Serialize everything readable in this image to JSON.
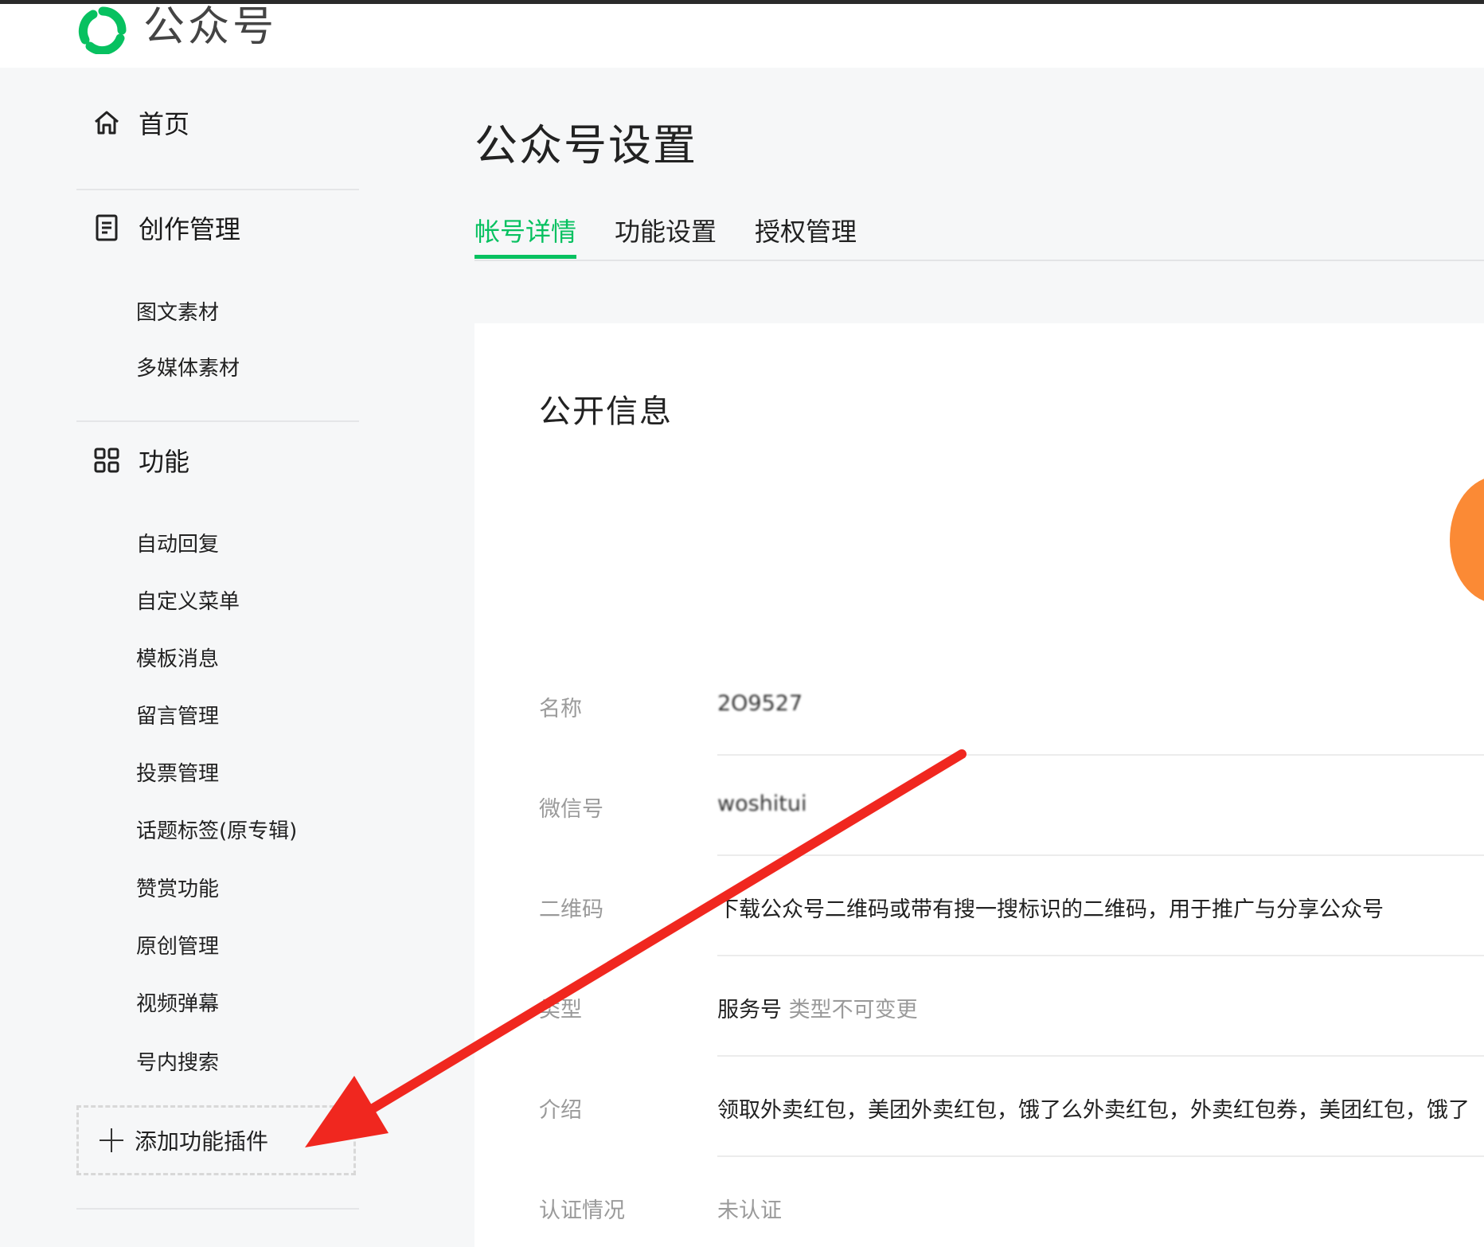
{
  "header": {
    "brand": "公众号"
  },
  "sidebar": {
    "home": "首页",
    "creation": {
      "title": "创作管理",
      "items": [
        "图文素材",
        "多媒体素材"
      ]
    },
    "features": {
      "title": "功能",
      "items": [
        "自动回复",
        "自定义菜单",
        "模板消息",
        "留言管理",
        "投票管理",
        "话题标签(原专辑)",
        "赞赏功能",
        "原创管理",
        "视频弹幕",
        "号内搜索"
      ]
    },
    "add_plugin": "添加功能插件"
  },
  "main": {
    "title": "公众号设置",
    "tabs": [
      "帐号详情",
      "功能设置",
      "授权管理"
    ],
    "section_title": "公开信息",
    "fields": {
      "name_label": "名称",
      "name_value": "2O9527",
      "wechat_id_label": "微信号",
      "wechat_id_value": "woshitui",
      "qrcode_label": "二维码",
      "qrcode_value": "下载公众号二维码或带有搜一搜标识的二维码，用于推广与分享公众号",
      "type_label": "类型",
      "type_value": "服务号",
      "type_note": "类型不可变更",
      "intro_label": "介绍",
      "intro_value": "领取外卖红包，美团外卖红包，饿了么外卖红包，外卖红包券，美团红包，饿了",
      "verify_label": "认证情况",
      "verify_value": "未认证"
    }
  },
  "colors": {
    "accent": "#07c160",
    "arrow": "#f0271f",
    "avatar": "#fb8a35"
  }
}
